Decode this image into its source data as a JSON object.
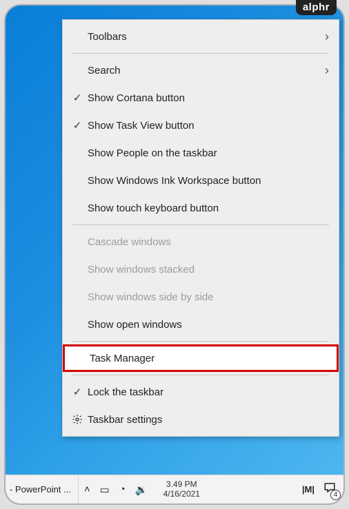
{
  "badge": "alphr",
  "menu": {
    "toolbars": "Toolbars",
    "search": "Search",
    "show_cortana": "Show Cortana button",
    "show_taskview": "Show Task View button",
    "show_people": "Show People on the taskbar",
    "show_ink": "Show Windows Ink Workspace button",
    "show_touch": "Show touch keyboard button",
    "cascade": "Cascade windows",
    "stacked": "Show windows stacked",
    "sidebyside": "Show windows side by side",
    "open_windows": "Show open windows",
    "task_manager": "Task Manager",
    "lock_taskbar": "Lock the taskbar",
    "taskbar_settings": "Taskbar settings"
  },
  "taskbar": {
    "app": "- PowerPoint ...",
    "time": "3.49 PM",
    "date": "4/16/2021",
    "notif_count": "4"
  }
}
